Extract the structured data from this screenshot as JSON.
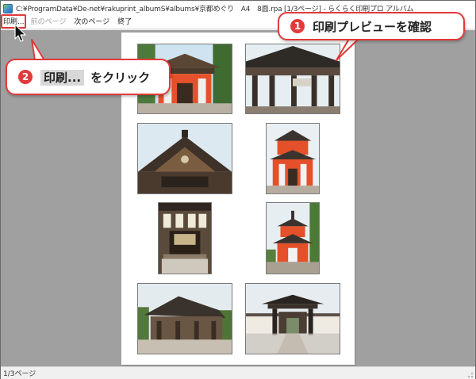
{
  "window": {
    "title": "C:¥ProgramData¥De-net¥rakuprint_albumS¥albums¥京都めぐり　A4　8面.rpa  [1/3ページ] - らくらく印刷プロ アルバム"
  },
  "menu": {
    "print": "印刷...",
    "prev_page": "前のページ",
    "next_page": "次のページ",
    "exit": "終了"
  },
  "status": {
    "page": "1/3ページ"
  },
  "callouts": {
    "first": {
      "number": "1",
      "text": "印刷プレビューを確認"
    },
    "second": {
      "number": "2",
      "chip": "印刷...",
      "text": "をクリック"
    }
  },
  "colors": {
    "accent": "#e23a3a",
    "canvas_bg": "#a0a0a0",
    "page_bg": "#ffffff"
  }
}
